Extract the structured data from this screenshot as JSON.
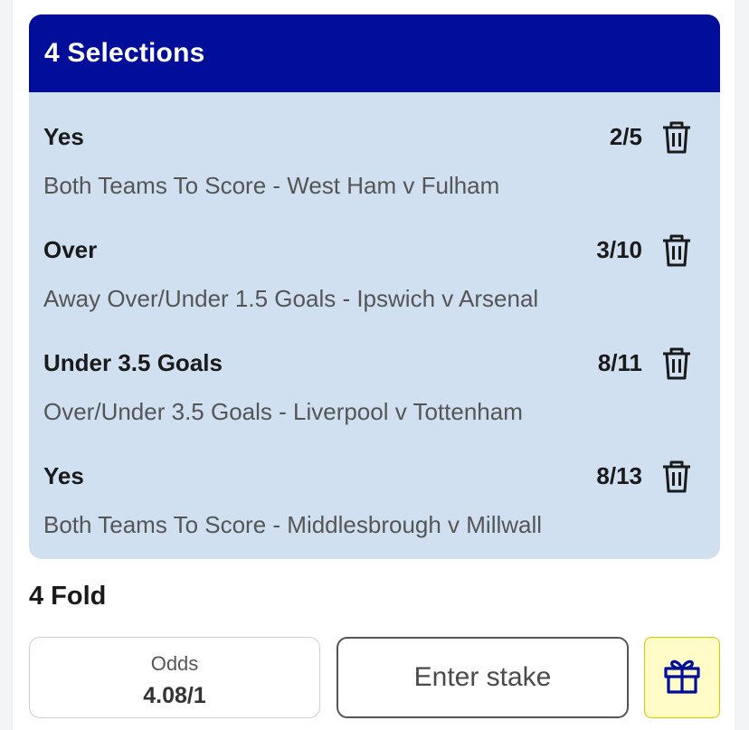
{
  "header": {
    "title": "4 Selections"
  },
  "selections": [
    {
      "name": "Yes",
      "odds": "2/5",
      "description": "Both Teams To Score - West Ham v Fulham",
      "icon": "trash-icon"
    },
    {
      "name": "Over",
      "odds": "3/10",
      "description": "Away Over/Under 1.5 Goals - Ipswich v Arsenal",
      "icon": "trash-icon"
    },
    {
      "name": "Under 3.5 Goals",
      "odds": "8/11",
      "description": "Over/Under 3.5 Goals - Liverpool v Tottenham",
      "icon": "trash-icon"
    },
    {
      "name": "Yes",
      "odds": "8/13",
      "description": "Both Teams To Score - Middlesbrough v Millwall",
      "icon": "trash-icon"
    }
  ],
  "fold": {
    "label": "4 Fold",
    "odds_caption": "Odds",
    "odds_value": "4.08/1",
    "stake_placeholder": "Enter stake",
    "stake_value": "",
    "gift_icon": "gift-icon"
  },
  "colors": {
    "header_bg": "#000e99",
    "card_bg": "#d0e0f0",
    "gift_bg": "#fffcc8",
    "gift_icon": "#000e99"
  }
}
